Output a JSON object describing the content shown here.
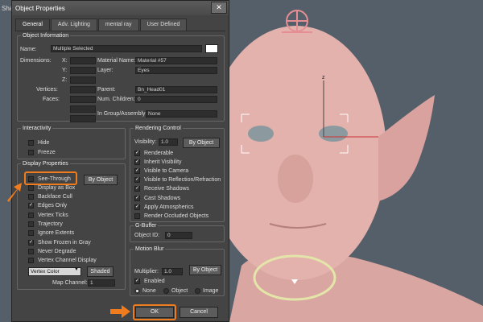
{
  "viewport": {
    "label": "Shade"
  },
  "dialog": {
    "title": "Object Properties",
    "close": "✕",
    "tabs": [
      "General",
      "Adv. Lighting",
      "mental ray",
      "User Defined"
    ]
  },
  "object_info": {
    "legend": "Object Information",
    "name_label": "Name:",
    "name_value": "Multiple Selected",
    "dimensions_label": "Dimensions:",
    "x_label": "X:",
    "y_label": "Y:",
    "z_label": "Z:",
    "vertices_label": "Vertices:",
    "faces_label": "Faces:",
    "material_name_label": "Material Name:",
    "material_name_value": "Material #57",
    "layer_label": "Layer:",
    "layer_value": "Eyes",
    "parent_label": "Parent:",
    "parent_value": "Bn_Head01",
    "num_children_label": "Num. Children:",
    "num_children_value": "0",
    "group_label": "In Group/Assembly:",
    "group_value": "None"
  },
  "interactivity": {
    "legend": "Interactivity",
    "hide": "Hide",
    "freeze": "Freeze"
  },
  "display_props": {
    "legend": "Display Properties",
    "by_object": "By Object",
    "items": [
      {
        "label": "See-Through",
        "checked": false
      },
      {
        "label": "Display as Box",
        "checked": false
      },
      {
        "label": "Backface Cull",
        "checked": false
      },
      {
        "label": "Edges Only",
        "checked": true
      },
      {
        "label": "Vertex Ticks",
        "checked": false
      },
      {
        "label": "Trajectory",
        "checked": false
      },
      {
        "label": "Ignore Extents",
        "checked": false
      },
      {
        "label": "Show Frozen in Gray",
        "checked": true
      },
      {
        "label": "Never Degrade",
        "checked": false
      },
      {
        "label": "Vertex Channel Display",
        "checked": false
      }
    ],
    "vertex_color": "Vertex Color",
    "shaded": "Shaded",
    "map_channel_label": "Map Channel:",
    "map_channel_value": "1"
  },
  "rendering": {
    "legend": "Rendering Control",
    "visibility_label": "Visibility:",
    "visibility_value": "1.0",
    "by_object": "By Object",
    "items": [
      {
        "label": "Renderable",
        "checked": true
      },
      {
        "label": "Inherit Visibility",
        "checked": true
      },
      {
        "label": "Visible to Camera",
        "checked": true
      },
      {
        "label": "Visible to Reflection/Refraction",
        "checked": true
      },
      {
        "label": "Receive Shadows",
        "checked": true
      },
      {
        "label": "Cast Shadows",
        "checked": true
      },
      {
        "label": "Apply Atmospherics",
        "checked": true
      },
      {
        "label": "Render Occluded Objects",
        "checked": false
      }
    ]
  },
  "gbuffer": {
    "legend": "G-Buffer",
    "object_id_label": "Object ID:",
    "object_id_value": "0"
  },
  "motion_blur": {
    "legend": "Motion Blur",
    "multiplier_label": "Multiplier:",
    "multiplier_value": "1.0",
    "by_object": "By Object",
    "enabled": "Enabled",
    "options": [
      "None",
      "Object",
      "Image"
    ],
    "selected": "None"
  },
  "footer": {
    "ok": "OK",
    "cancel": "Cancel"
  },
  "colors": {
    "accent": "#f07c1e",
    "skin": "#e3b2ad",
    "ring": "#e3e6a8"
  }
}
